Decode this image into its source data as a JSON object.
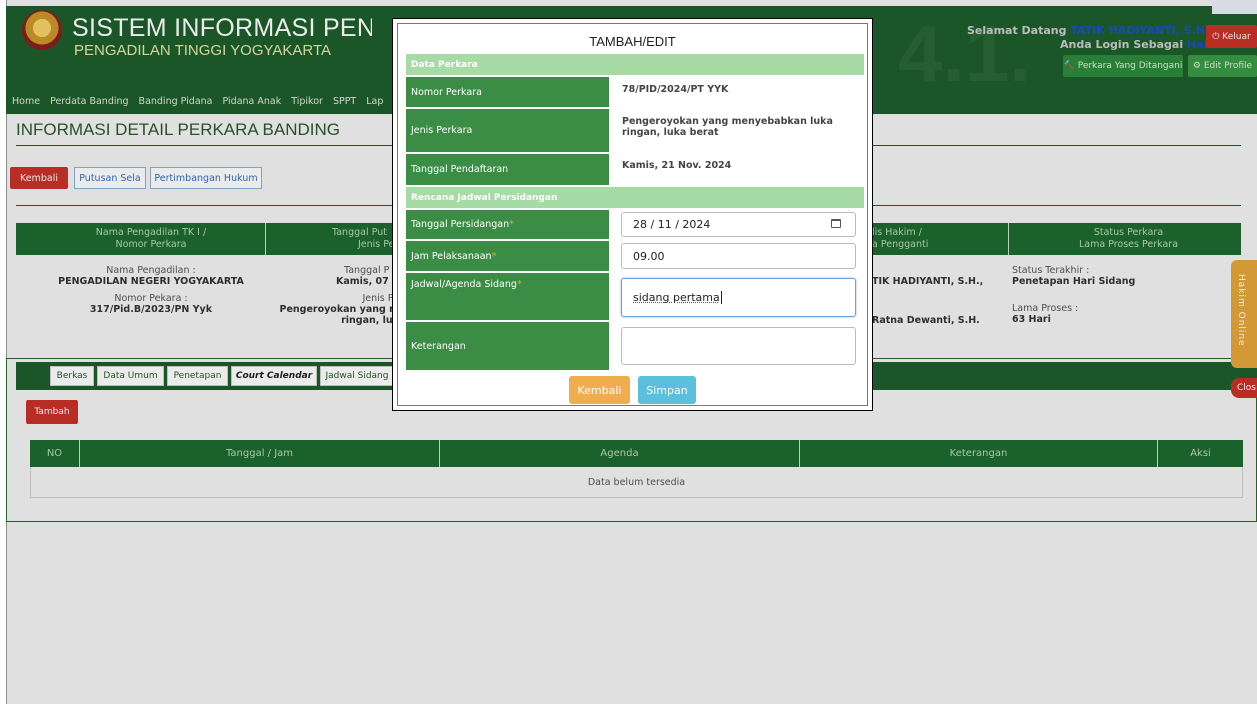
{
  "header": {
    "title": "SISTEM INFORMASI PENELUSURAN PE",
    "subtitle": "PENGADILAN TINGGI YOGYAKARTA",
    "welcome_prefix": "Selamat Datang",
    "user_name": "TATIK HADIYANTI, S.H., M.H.",
    "login_prefix": "Anda Login Sebagai",
    "role": "Hakim",
    "logout_label": "⏻ Keluar",
    "cases_button": "🔨 Perkara Yang Ditangani",
    "profile_button": "⚙ Edit Profile",
    "watermark": "4.1."
  },
  "nav": {
    "items": [
      "Home",
      "Perdata Banding",
      "Banding Pidana",
      "Pidana Anak",
      "Tipikor",
      "SPPT",
      "Lap"
    ]
  },
  "page": {
    "title": "INFORMASI DETAIL PERKARA BANDING",
    "back": "Kembali",
    "putusan_sela": "Putusan Sela",
    "pertimbangan": "Pertimbangan Hukum"
  },
  "detail": {
    "headers": {
      "c1a": "Nama Pengadilan TK I /",
      "c1b": "Nomor Perkara",
      "c2a": "Tanggal Put",
      "c2b": "Jenis Pe",
      "c3a": "lis Hakim /",
      "c3b": "a Pengganti",
      "c4a": "Status Perkara",
      "c4b": "Lama Proses Perkara"
    },
    "court_label": "Nama Pengadilan :",
    "court_value": "PENGADILAN NEGERI YOGYAKARTA",
    "number_label": "Nomor Pekara :",
    "number_value": "317/Pid.B/2023/PN Yyk",
    "date_label": "Tanggal P",
    "date_value": "Kamis, 07 D",
    "type_label": "Jenis Pe",
    "type_value1": "Pengeroyokan yang m",
    "type_value2": "ringan, luk",
    "judge_value": "TIK HADIYANTI, S.H.,",
    "clerk_value": "Ratna Dewanti, S.H.",
    "status_label": "Status Terakhir :",
    "status_value": "Penetapan Hari Sidang",
    "duration_label": "Lama Proses :",
    "duration_value": "63 Hari"
  },
  "tabs": [
    "Berkas",
    "Data Umum",
    "Penetapan",
    "Court Calendar",
    "Jadwal Sidang"
  ],
  "table": {
    "add_button": "Tambah",
    "headers": [
      "NO",
      "Tanggal / Jam",
      "Agenda",
      "Keterangan",
      "Aksi"
    ],
    "empty": "Data belum tersedia"
  },
  "side": {
    "widget": "Hakim Online",
    "close": "Clos"
  },
  "modal": {
    "title": "TAMBAH/EDIT",
    "section1": "Data Perkara",
    "case_number_label": "Nomor Perkara",
    "case_number": "78/PID/2024/PT YYK",
    "case_type_label": "Jenis Perkara",
    "case_type": "Pengeroyokan yang menyebabkan luka ringan, luka berat",
    "reg_date_label": "Tanggal Pendaftaran",
    "reg_date": "Kamis, 21 Nov. 2024",
    "section2": "Rencana Jadwal Persidangan",
    "hearing_date_label": "Tanggal Persidangan",
    "hearing_date": "28 / 11 / 2024",
    "time_label": "Jam Pelaksanaan",
    "time": "09.00",
    "agenda_label": "Jadwal/Agenda Sidang",
    "agenda": "sidang pertama",
    "notes_label": "Keterangan",
    "notes": "",
    "required_mark": "*",
    "back_button": "Kembali",
    "save_button": "Simpan"
  },
  "colors": {
    "header_green": "#1e5e2c",
    "label_green": "#3b8d45",
    "section_green": "#a6dba6",
    "danger": "#c83228",
    "warning": "#f0ad4e",
    "info": "#5bc0de"
  }
}
